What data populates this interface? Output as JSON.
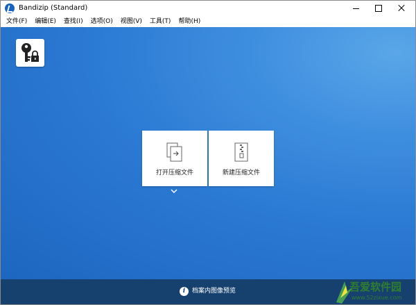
{
  "window": {
    "title": "Bandizip (Standard)",
    "accent_color": "#1565c0"
  },
  "menu": {
    "items": [
      "文件(F)",
      "编辑(E)",
      "查找(I)",
      "选项(O)",
      "视图(V)",
      "工具(T)",
      "帮助(H)"
    ]
  },
  "main": {
    "background_color": "#2a79d3",
    "key_button_icon": "key-lock-icon",
    "tiles": [
      {
        "label": "打开压缩文件",
        "icon": "open-archive-icon"
      },
      {
        "label": "新建压缩文件",
        "icon": "new-archive-icon"
      }
    ],
    "expand_icon": "chevron-down-icon"
  },
  "bottom_bar": {
    "icon": "info-icon",
    "label": "档案内图像预览",
    "background_color": "#16416e"
  },
  "watermark": {
    "text": "吾爱软件园",
    "url": "www.52zixue.com"
  }
}
